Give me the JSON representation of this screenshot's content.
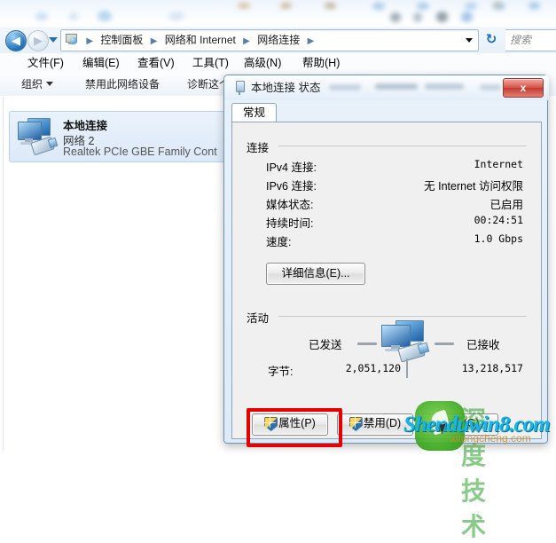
{
  "explorer": {
    "nav": {
      "back_icon": "back-arrow-icon",
      "back_glyph": "◀",
      "forward_icon": "forward-arrow-icon",
      "forward_glyph": "▶",
      "history_dropdown_icon": "chevron-down-icon"
    },
    "breadcrumb": {
      "icon": "network-control-panel-icon",
      "items": [
        "控制面板",
        "网络和 Internet",
        "网络连接"
      ],
      "separator": "▶",
      "dropdown_icon": "chevron-down-icon"
    },
    "refresh": {
      "icon": "refresh-icon",
      "glyph": "↻"
    },
    "search": {
      "placeholder": "搜索",
      "icon": "search-icon"
    },
    "menubar": [
      "文件(F)",
      "编辑(E)",
      "查看(V)",
      "工具(T)",
      "高级(N)",
      "帮助(H)"
    ],
    "toolbar": [
      "组织",
      "禁用此网络设备",
      "诊断这个连接"
    ],
    "connection_item": {
      "icon": "network-adapter-icon",
      "name": "本地连接",
      "network": "网络  2",
      "adapter": "Realtek PCIe GBE Family Cont"
    }
  },
  "dialog": {
    "icon": "network-status-icon",
    "title": "本地连接 状态",
    "close_label": "x",
    "tabs": [
      {
        "label": "常规"
      }
    ],
    "connection_group": {
      "label": "连接",
      "rows": [
        {
          "label": "IPv4 连接:",
          "value": "Internet",
          "mono": true
        },
        {
          "label": "IPv6 连接:",
          "value": "无 Internet 访问权限",
          "mono": false
        },
        {
          "label": "媒体状态:",
          "value": "已启用",
          "mono": false
        },
        {
          "label": "持续时间:",
          "value": "00:24:51",
          "mono": true
        },
        {
          "label": "速度:",
          "value": "1.0 Gbps",
          "mono": true
        }
      ],
      "details_button": "详细信息(E)..."
    },
    "activity_group": {
      "label": "活动",
      "sent_label": "已发送",
      "received_label": "已接收",
      "icon": "activity-computer-icon",
      "bytes_label": "字节:",
      "bytes_sent": "2,051,120",
      "bytes_received": "13,218,517"
    },
    "buttons": [
      {
        "label": "属性(P)",
        "icon": "uac-shield-icon",
        "highlighted": true
      },
      {
        "label": "禁用(D)",
        "icon": "uac-shield-icon",
        "highlighted": false
      },
      {
        "label": "诊断(G)",
        "icon": "",
        "highlighted": false
      }
    ],
    "highlight_color": "#e60000"
  },
  "watermark": {
    "primary": "Shenduwin8.com",
    "secondary": "xitongcheng.com",
    "chinese": "深度技术",
    "logo_icon": "green-leaf-logo-icon"
  }
}
